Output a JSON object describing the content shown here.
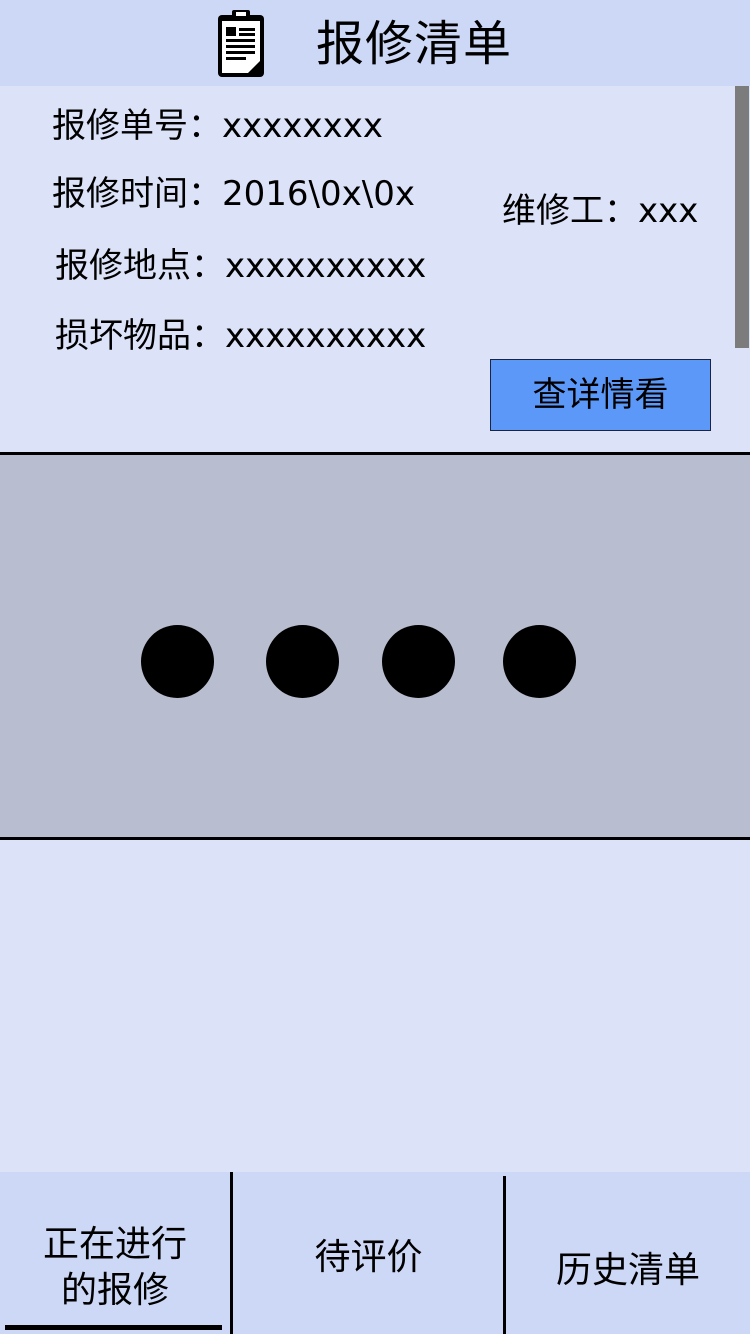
{
  "header": {
    "icon": "clipboard-icon",
    "title": "报修清单"
  },
  "order": {
    "order_number": "报修单号：xxxxxxxx",
    "repair_time": "报修时间：2016\\0x\\0x",
    "repair_location": "报修地点：xxxxxxxxxx",
    "damaged_item": "损坏物品：xxxxxxxxxx",
    "technician": "维修工：xxx",
    "detail_button": "查详情看"
  },
  "loading": {
    "dot_count": 4
  },
  "tabs": [
    {
      "label_line1": "正在进行",
      "label_line2": "的报修",
      "active": true
    },
    {
      "label": "待评价",
      "active": false
    },
    {
      "label": "历史清单",
      "active": false
    }
  ],
  "colors": {
    "background": "#dce3f8",
    "header": "#cdd8f6",
    "button": "#5c98f7",
    "panel": "#b8becf"
  }
}
